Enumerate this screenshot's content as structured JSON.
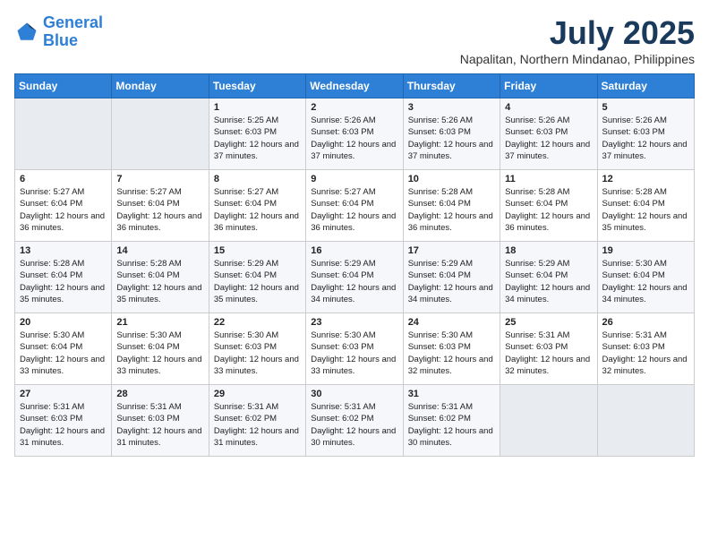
{
  "header": {
    "logo_line1": "General",
    "logo_line2": "Blue",
    "month": "July 2025",
    "location": "Napalitan, Northern Mindanao, Philippines"
  },
  "weekdays": [
    "Sunday",
    "Monday",
    "Tuesday",
    "Wednesday",
    "Thursday",
    "Friday",
    "Saturday"
  ],
  "weeks": [
    [
      {
        "day": "",
        "sunrise": "",
        "sunset": "",
        "daylight": ""
      },
      {
        "day": "",
        "sunrise": "",
        "sunset": "",
        "daylight": ""
      },
      {
        "day": "1",
        "sunrise": "Sunrise: 5:25 AM",
        "sunset": "Sunset: 6:03 PM",
        "daylight": "Daylight: 12 hours and 37 minutes."
      },
      {
        "day": "2",
        "sunrise": "Sunrise: 5:26 AM",
        "sunset": "Sunset: 6:03 PM",
        "daylight": "Daylight: 12 hours and 37 minutes."
      },
      {
        "day": "3",
        "sunrise": "Sunrise: 5:26 AM",
        "sunset": "Sunset: 6:03 PM",
        "daylight": "Daylight: 12 hours and 37 minutes."
      },
      {
        "day": "4",
        "sunrise": "Sunrise: 5:26 AM",
        "sunset": "Sunset: 6:03 PM",
        "daylight": "Daylight: 12 hours and 37 minutes."
      },
      {
        "day": "5",
        "sunrise": "Sunrise: 5:26 AM",
        "sunset": "Sunset: 6:03 PM",
        "daylight": "Daylight: 12 hours and 37 minutes."
      }
    ],
    [
      {
        "day": "6",
        "sunrise": "Sunrise: 5:27 AM",
        "sunset": "Sunset: 6:04 PM",
        "daylight": "Daylight: 12 hours and 36 minutes."
      },
      {
        "day": "7",
        "sunrise": "Sunrise: 5:27 AM",
        "sunset": "Sunset: 6:04 PM",
        "daylight": "Daylight: 12 hours and 36 minutes."
      },
      {
        "day": "8",
        "sunrise": "Sunrise: 5:27 AM",
        "sunset": "Sunset: 6:04 PM",
        "daylight": "Daylight: 12 hours and 36 minutes."
      },
      {
        "day": "9",
        "sunrise": "Sunrise: 5:27 AM",
        "sunset": "Sunset: 6:04 PM",
        "daylight": "Daylight: 12 hours and 36 minutes."
      },
      {
        "day": "10",
        "sunrise": "Sunrise: 5:28 AM",
        "sunset": "Sunset: 6:04 PM",
        "daylight": "Daylight: 12 hours and 36 minutes."
      },
      {
        "day": "11",
        "sunrise": "Sunrise: 5:28 AM",
        "sunset": "Sunset: 6:04 PM",
        "daylight": "Daylight: 12 hours and 36 minutes."
      },
      {
        "day": "12",
        "sunrise": "Sunrise: 5:28 AM",
        "sunset": "Sunset: 6:04 PM",
        "daylight": "Daylight: 12 hours and 35 minutes."
      }
    ],
    [
      {
        "day": "13",
        "sunrise": "Sunrise: 5:28 AM",
        "sunset": "Sunset: 6:04 PM",
        "daylight": "Daylight: 12 hours and 35 minutes."
      },
      {
        "day": "14",
        "sunrise": "Sunrise: 5:28 AM",
        "sunset": "Sunset: 6:04 PM",
        "daylight": "Daylight: 12 hours and 35 minutes."
      },
      {
        "day": "15",
        "sunrise": "Sunrise: 5:29 AM",
        "sunset": "Sunset: 6:04 PM",
        "daylight": "Daylight: 12 hours and 35 minutes."
      },
      {
        "day": "16",
        "sunrise": "Sunrise: 5:29 AM",
        "sunset": "Sunset: 6:04 PM",
        "daylight": "Daylight: 12 hours and 34 minutes."
      },
      {
        "day": "17",
        "sunrise": "Sunrise: 5:29 AM",
        "sunset": "Sunset: 6:04 PM",
        "daylight": "Daylight: 12 hours and 34 minutes."
      },
      {
        "day": "18",
        "sunrise": "Sunrise: 5:29 AM",
        "sunset": "Sunset: 6:04 PM",
        "daylight": "Daylight: 12 hours and 34 minutes."
      },
      {
        "day": "19",
        "sunrise": "Sunrise: 5:30 AM",
        "sunset": "Sunset: 6:04 PM",
        "daylight": "Daylight: 12 hours and 34 minutes."
      }
    ],
    [
      {
        "day": "20",
        "sunrise": "Sunrise: 5:30 AM",
        "sunset": "Sunset: 6:04 PM",
        "daylight": "Daylight: 12 hours and 33 minutes."
      },
      {
        "day": "21",
        "sunrise": "Sunrise: 5:30 AM",
        "sunset": "Sunset: 6:04 PM",
        "daylight": "Daylight: 12 hours and 33 minutes."
      },
      {
        "day": "22",
        "sunrise": "Sunrise: 5:30 AM",
        "sunset": "Sunset: 6:03 PM",
        "daylight": "Daylight: 12 hours and 33 minutes."
      },
      {
        "day": "23",
        "sunrise": "Sunrise: 5:30 AM",
        "sunset": "Sunset: 6:03 PM",
        "daylight": "Daylight: 12 hours and 33 minutes."
      },
      {
        "day": "24",
        "sunrise": "Sunrise: 5:30 AM",
        "sunset": "Sunset: 6:03 PM",
        "daylight": "Daylight: 12 hours and 32 minutes."
      },
      {
        "day": "25",
        "sunrise": "Sunrise: 5:31 AM",
        "sunset": "Sunset: 6:03 PM",
        "daylight": "Daylight: 12 hours and 32 minutes."
      },
      {
        "day": "26",
        "sunrise": "Sunrise: 5:31 AM",
        "sunset": "Sunset: 6:03 PM",
        "daylight": "Daylight: 12 hours and 32 minutes."
      }
    ],
    [
      {
        "day": "27",
        "sunrise": "Sunrise: 5:31 AM",
        "sunset": "Sunset: 6:03 PM",
        "daylight": "Daylight: 12 hours and 31 minutes."
      },
      {
        "day": "28",
        "sunrise": "Sunrise: 5:31 AM",
        "sunset": "Sunset: 6:03 PM",
        "daylight": "Daylight: 12 hours and 31 minutes."
      },
      {
        "day": "29",
        "sunrise": "Sunrise: 5:31 AM",
        "sunset": "Sunset: 6:02 PM",
        "daylight": "Daylight: 12 hours and 31 minutes."
      },
      {
        "day": "30",
        "sunrise": "Sunrise: 5:31 AM",
        "sunset": "Sunset: 6:02 PM",
        "daylight": "Daylight: 12 hours and 30 minutes."
      },
      {
        "day": "31",
        "sunrise": "Sunrise: 5:31 AM",
        "sunset": "Sunset: 6:02 PM",
        "daylight": "Daylight: 12 hours and 30 minutes."
      },
      {
        "day": "",
        "sunrise": "",
        "sunset": "",
        "daylight": ""
      },
      {
        "day": "",
        "sunrise": "",
        "sunset": "",
        "daylight": ""
      }
    ]
  ]
}
